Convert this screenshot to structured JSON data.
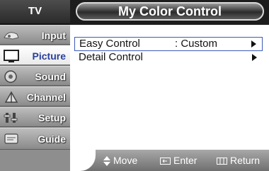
{
  "sidebar": {
    "header": "TV",
    "items": [
      {
        "label": "Input",
        "icon": "input-icon"
      },
      {
        "label": "Picture",
        "icon": "picture-icon",
        "selected": true
      },
      {
        "label": "Sound",
        "icon": "sound-icon"
      },
      {
        "label": "Channel",
        "icon": "channel-icon"
      },
      {
        "label": "Setup",
        "icon": "setup-icon"
      },
      {
        "label": "Guide",
        "icon": "guide-icon"
      }
    ]
  },
  "title": "My Color Control",
  "menu": [
    {
      "label": "Easy Control",
      "value": ": Custom",
      "highlighted": true
    },
    {
      "label": "Detail Control",
      "value": "",
      "highlighted": false
    }
  ],
  "footer": {
    "move": "Move",
    "enter": "Enter",
    "return": "Return"
  },
  "colors": {
    "highlight_border": "#3d5bb8",
    "selected_label": "#2a3f9e"
  }
}
